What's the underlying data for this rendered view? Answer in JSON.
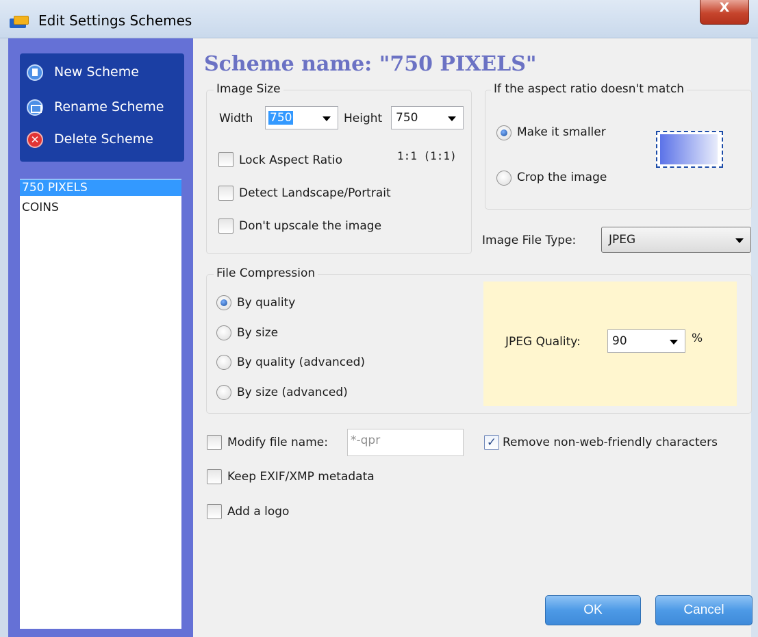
{
  "window": {
    "title": "Edit Settings Schemes",
    "close_glyph": "X"
  },
  "sidebar": {
    "actions": [
      {
        "label": "New Scheme",
        "icon": "new-document-icon"
      },
      {
        "label": "Rename Scheme",
        "icon": "rename-icon"
      },
      {
        "label": "Delete Scheme",
        "icon": "delete-icon"
      }
    ],
    "schemes": [
      "750 PIXELS",
      "COINS"
    ],
    "selected_scheme": "750 PIXELS"
  },
  "main": {
    "scheme_title": "Scheme name: \"750 PIXELS\"",
    "image_size": {
      "legend": "Image Size",
      "width_label": "Width",
      "width_value": "750",
      "height_label": "Height",
      "height_value": "750",
      "ratio_text": "1:1 (1:1)",
      "lock_aspect_label": "Lock Aspect Ratio",
      "lock_aspect_checked": false,
      "detect_orientation_label": "Detect Landscape/Portrait",
      "detect_orientation_checked": false,
      "no_upscale_label": "Don't upscale the image",
      "no_upscale_checked": false
    },
    "aspect": {
      "legend": "If the aspect ratio doesn't match",
      "option_smaller": "Make it smaller",
      "option_crop": "Crop the image",
      "selected": "Make it smaller"
    },
    "file_type": {
      "label": "Image File Type:",
      "value": "JPEG"
    },
    "compression": {
      "legend": "File Compression",
      "options": [
        "By quality",
        "By size",
        "By quality (advanced)",
        "By size (advanced)"
      ],
      "selected": "By quality",
      "quality_label": "JPEG Quality:",
      "quality_value": "90",
      "quality_unit": "%"
    },
    "options": {
      "modify_filename_label": "Modify file name:",
      "modify_filename_checked": false,
      "filename_placeholder": "*-qpr",
      "remove_chars_label": "Remove non-web-friendly characters",
      "remove_chars_checked": true,
      "keep_metadata_label": "Keep EXIF/XMP metadata",
      "keep_metadata_checked": false,
      "add_logo_label": "Add a logo",
      "add_logo_checked": false
    },
    "buttons": {
      "ok": "OK",
      "cancel": "Cancel"
    }
  },
  "colors": {
    "title_bar": "#c9d9ec",
    "sidebar_bg": "#6571d6",
    "actions_bg": "#1b3fa4",
    "selection": "#3399ff",
    "scheme_title": "#6b72c4",
    "quality_panel": "#fff6cf",
    "button": "#4d9ae6",
    "close_button": "#c6452d"
  }
}
